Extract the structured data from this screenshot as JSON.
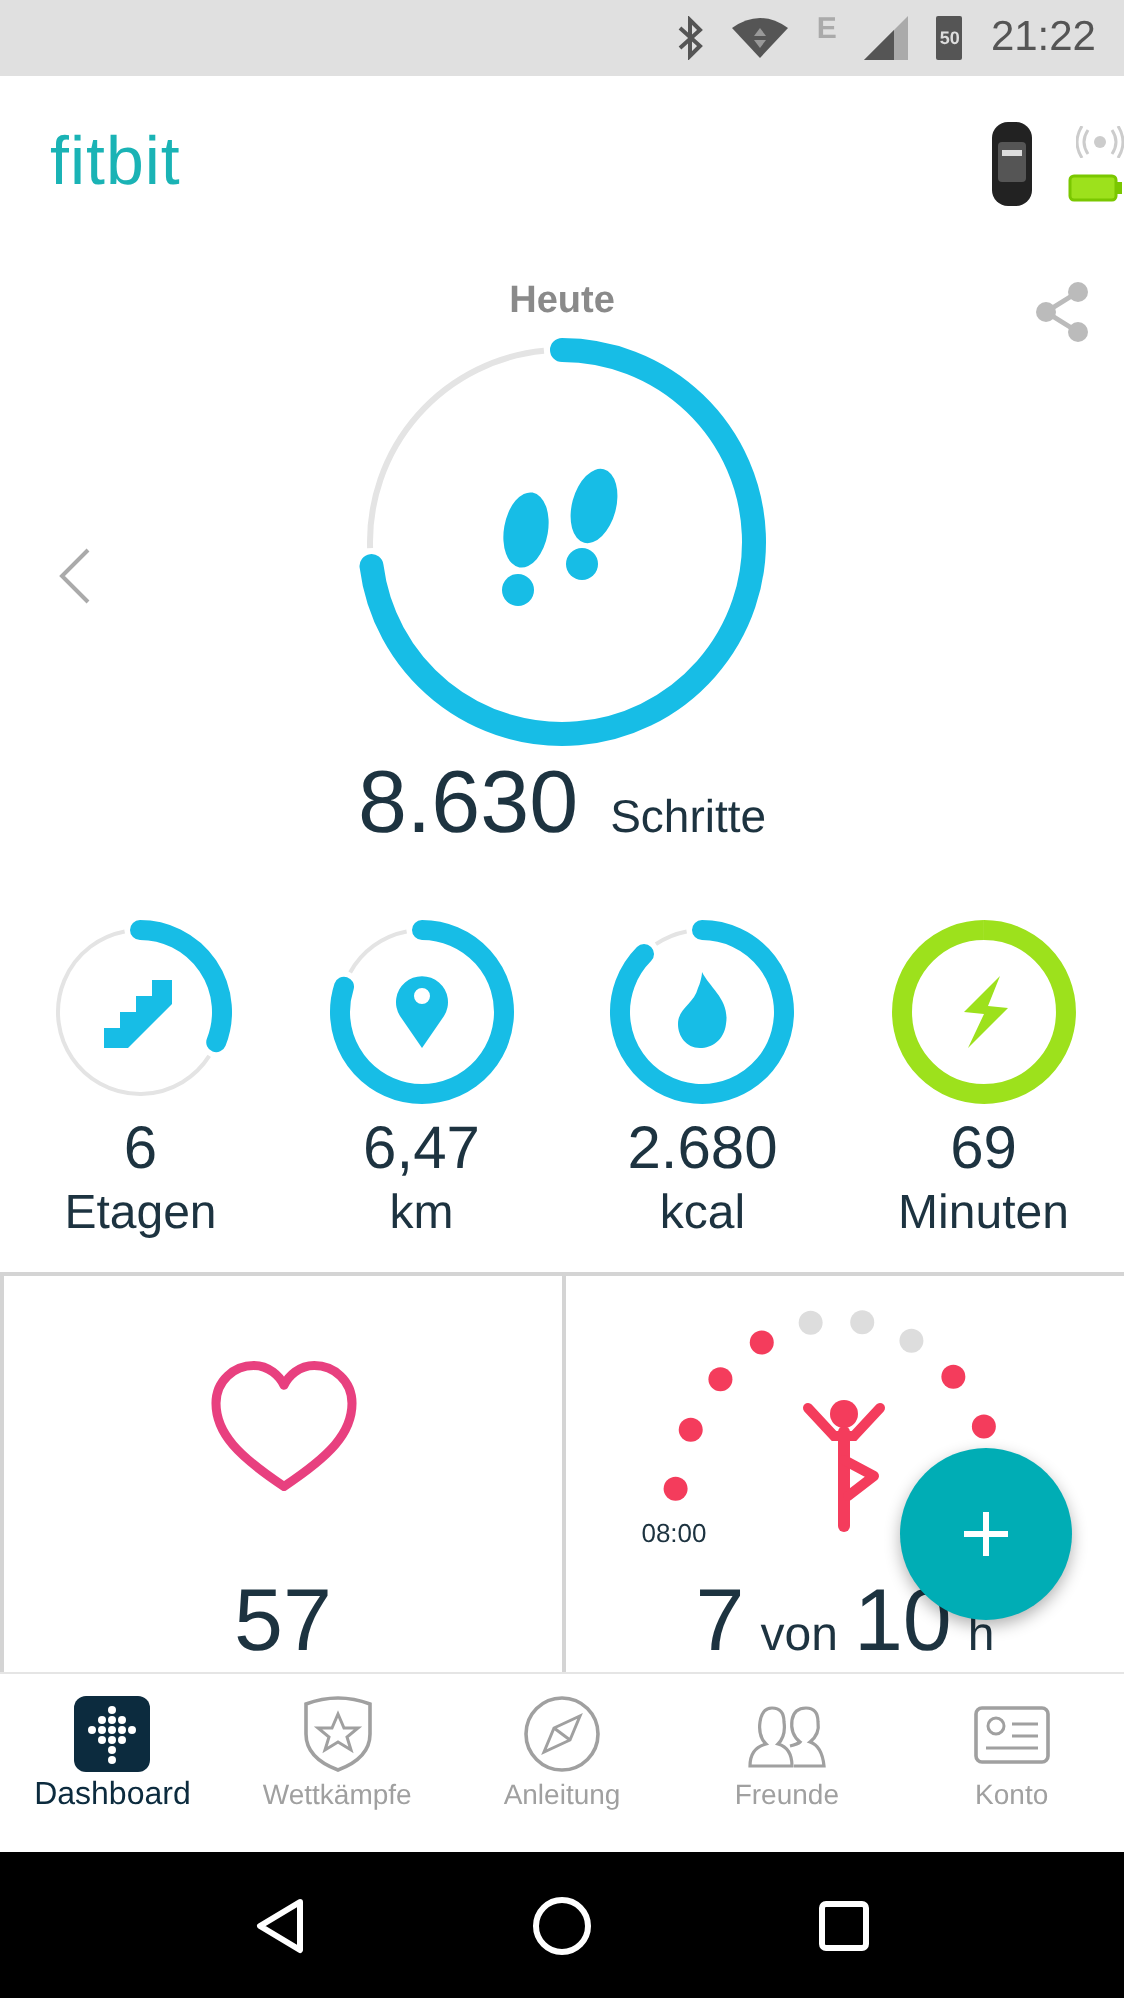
{
  "status_bar": {
    "network": "E",
    "battery": "50",
    "time": "21:22"
  },
  "header": {
    "logo": "fitbit"
  },
  "today": {
    "title": "Heute",
    "steps": "8.630",
    "unit": "Schritte"
  },
  "stats": [
    {
      "kind": "floors",
      "value": "6",
      "label": "Etagen"
    },
    {
      "kind": "distance",
      "value": "6,47",
      "label": "km"
    },
    {
      "kind": "calories",
      "value": "2.680",
      "label": "kcal"
    },
    {
      "kind": "active",
      "value": "69",
      "label": "Minuten"
    }
  ],
  "heart_tile": {
    "value": "57"
  },
  "hourly_tile": {
    "start": "08:00",
    "value": "7",
    "of": "von",
    "goal": "10",
    "unit": "h",
    "dots": [
      {
        "done": true
      },
      {
        "done": true
      },
      {
        "done": true
      },
      {
        "done": true
      },
      {
        "done": false
      },
      {
        "done": false
      },
      {
        "done": false
      },
      {
        "done": true
      },
      {
        "done": true
      }
    ]
  },
  "nav": [
    {
      "kind": "dashboard",
      "label": "Dashboard",
      "selected": true
    },
    {
      "kind": "challenges",
      "label": "Wettkämpfe",
      "selected": false
    },
    {
      "kind": "guidance",
      "label": "Anleitung",
      "selected": false
    },
    {
      "kind": "friends",
      "label": "Freunde",
      "selected": false
    },
    {
      "kind": "account",
      "label": "Konto",
      "selected": false
    }
  ]
}
